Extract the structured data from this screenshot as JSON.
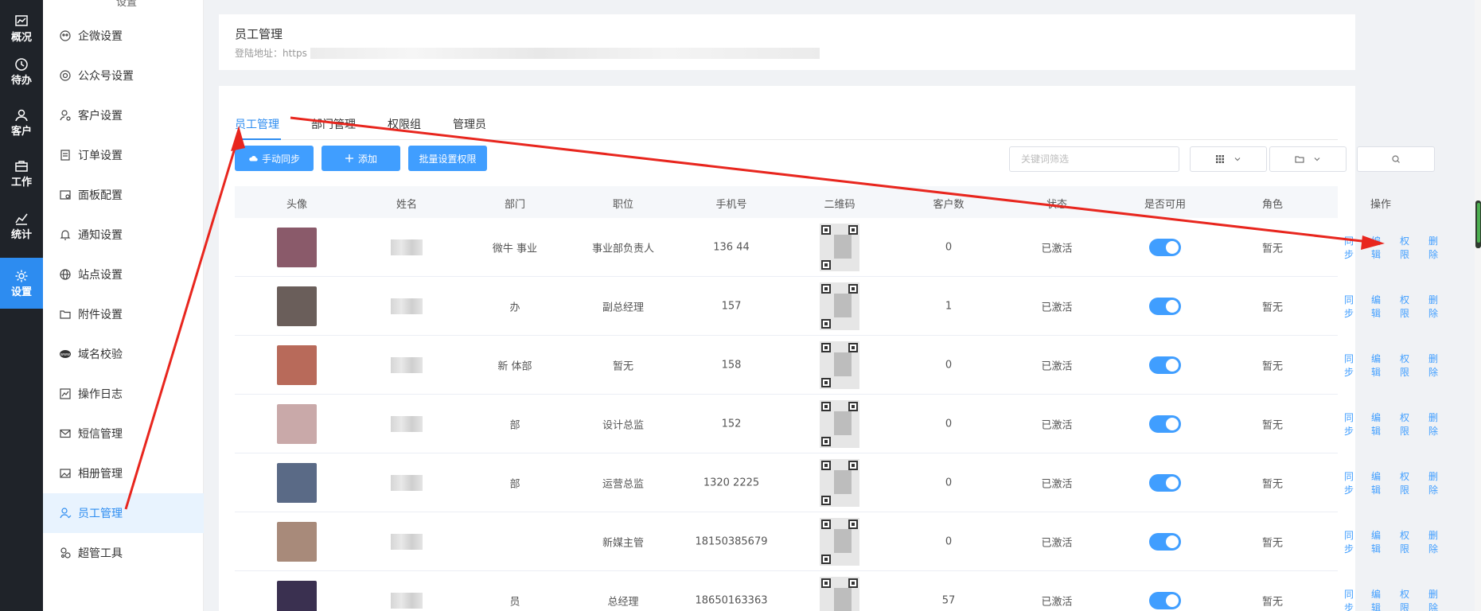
{
  "rail": {
    "items": [
      {
        "label": "概况",
        "icon": "chart-icon"
      },
      {
        "label": "待办",
        "icon": "clock-icon"
      },
      {
        "label": "客户",
        "icon": "user-icon"
      },
      {
        "label": "工作",
        "icon": "briefcase-icon"
      },
      {
        "label": "统计",
        "icon": "stats-icon"
      },
      {
        "label": "设置",
        "icon": "gear-icon",
        "active": true
      }
    ]
  },
  "menu": {
    "top_partial": "设置",
    "items": [
      {
        "label": "企微设置",
        "icon": "wecom-icon"
      },
      {
        "label": "公众号设置",
        "icon": "settings-icon"
      },
      {
        "label": "客户设置",
        "icon": "user-gear-icon"
      },
      {
        "label": "订单设置",
        "icon": "order-icon"
      },
      {
        "label": "面板配置",
        "icon": "panel-icon"
      },
      {
        "label": "通知设置",
        "icon": "bell-icon"
      },
      {
        "label": "站点设置",
        "icon": "globe-icon"
      },
      {
        "label": "附件设置",
        "icon": "folder-icon"
      },
      {
        "label": "域名校验",
        "icon": "www-icon"
      },
      {
        "label": "操作日志",
        "icon": "log-icon"
      },
      {
        "label": "短信管理",
        "icon": "mail-icon"
      },
      {
        "label": "相册管理",
        "icon": "image-icon"
      },
      {
        "label": "员工管理",
        "icon": "staff-icon",
        "active": true
      },
      {
        "label": "超管工具",
        "icon": "tool-icon"
      }
    ]
  },
  "header": {
    "title": "员工管理",
    "login_label": "登陆地址：https"
  },
  "tabs": [
    "员工管理",
    "部门管理",
    "权限组",
    "管理员"
  ],
  "toolbar": {
    "sync_label": "手动同步",
    "add_label": "添加",
    "batch_label": "批量设置权限",
    "search_placeholder": "关键词筛选"
  },
  "table": {
    "columns": [
      "头像",
      "姓名",
      "部门",
      "职位",
      "手机号",
      "二维码",
      "客户数",
      "状态",
      "是否可用",
      "角色",
      "操作"
    ],
    "rows": [
      {
        "dept": "微牛  事业",
        "position": "事业部负责人",
        "phone": "136    44",
        "customers": "0",
        "status": "已激活",
        "role": "暂无",
        "avatar_color": "#8a5a6a"
      },
      {
        "dept": "办",
        "position": "副总经理",
        "phone": "157",
        "customers": "1",
        "status": "已激活",
        "role": "暂无",
        "avatar_color": "#6a5e5a"
      },
      {
        "dept": "新  体部",
        "position": "暂无",
        "phone": "158",
        "customers": "0",
        "status": "已激活",
        "role": "暂无",
        "avatar_color": "#b86a5a"
      },
      {
        "dept": "部",
        "position": "设计总监",
        "phone": "152",
        "customers": "0",
        "status": "已激活",
        "role": "暂无",
        "avatar_color": "#c9a9a9"
      },
      {
        "dept": "部",
        "position": "运营总监",
        "phone": "1320    2225",
        "customers": "0",
        "status": "已激活",
        "role": "暂无",
        "avatar_color": "#5a6a86"
      },
      {
        "dept": "",
        "position": "新媒主管",
        "phone": "18150385679",
        "customers": "0",
        "status": "已激活",
        "role": "暂无",
        "avatar_color": "#a88a7a"
      },
      {
        "dept": "员",
        "position": "总经理",
        "phone": "18650163363",
        "customers": "57",
        "status": "已激活",
        "role": "暂无",
        "avatar_color": "#3a3050"
      }
    ],
    "ops": [
      "同步",
      "编辑",
      "权限",
      "删除"
    ]
  },
  "colors": {
    "primary": "#409eff",
    "rail_bg": "#1f2329",
    "annotation": "#e8261e"
  }
}
